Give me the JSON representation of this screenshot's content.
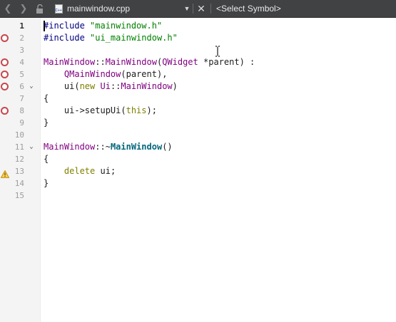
{
  "toolbar": {
    "back_icon": "chevron-left-icon",
    "forward_icon": "chevron-right-icon",
    "lock_icon": "unlocked-icon",
    "file_badge": "C++",
    "filename": "mainwindow.cpp",
    "close_icon": "close-icon",
    "symbol_placeholder": "<Select Symbol>"
  },
  "editor": {
    "current_line": 1,
    "lines": [
      {
        "number": "1"
      },
      {
        "number": "2",
        "marker": "breakpoint"
      },
      {
        "number": "3"
      },
      {
        "number": "4",
        "marker": "breakpoint"
      },
      {
        "number": "5",
        "marker": "breakpoint"
      },
      {
        "number": "6",
        "marker": "breakpoint",
        "fold": true
      },
      {
        "number": "7"
      },
      {
        "number": "8",
        "marker": "breakpoint"
      },
      {
        "number": "9"
      },
      {
        "number": "10"
      },
      {
        "number": "11",
        "fold": true
      },
      {
        "number": "12"
      },
      {
        "number": "13",
        "marker": "warning"
      },
      {
        "number": "14"
      },
      {
        "number": "15"
      }
    ],
    "tokens": {
      "l1": [
        "#include",
        " ",
        "\"mainwindow.h\""
      ],
      "l2": [
        "#include",
        " ",
        "\"ui_mainwindow.h\""
      ],
      "l4": [
        "MainWindow",
        "::",
        "MainWindow",
        "(",
        "QWidget",
        " *parent) :"
      ],
      "l5": [
        "    ",
        "QMainWindow",
        "(parent),"
      ],
      "l6": [
        "    ui(",
        "new",
        " ",
        "Ui",
        "::",
        "MainWindow",
        ")"
      ],
      "l7": [
        "{"
      ],
      "l8": [
        "    ui->setupUi(",
        "this",
        ");"
      ],
      "l9": [
        "}"
      ],
      "l11": [
        "MainWindow",
        "::~",
        "MainWindow",
        "()"
      ],
      "l12": [
        "{"
      ],
      "l13": [
        "    ",
        "delete",
        " ui;"
      ],
      "l14": [
        "}"
      ]
    }
  },
  "colors": {
    "toolbar_bg": "#404244",
    "gutter_bg": "#f4f4f4",
    "breakpoint": "#c8464c",
    "warning": "#e8b320",
    "preprocessor": "#000080",
    "string": "#008000",
    "type": "#800080",
    "keyword": "#808000",
    "function": "#00677c"
  }
}
